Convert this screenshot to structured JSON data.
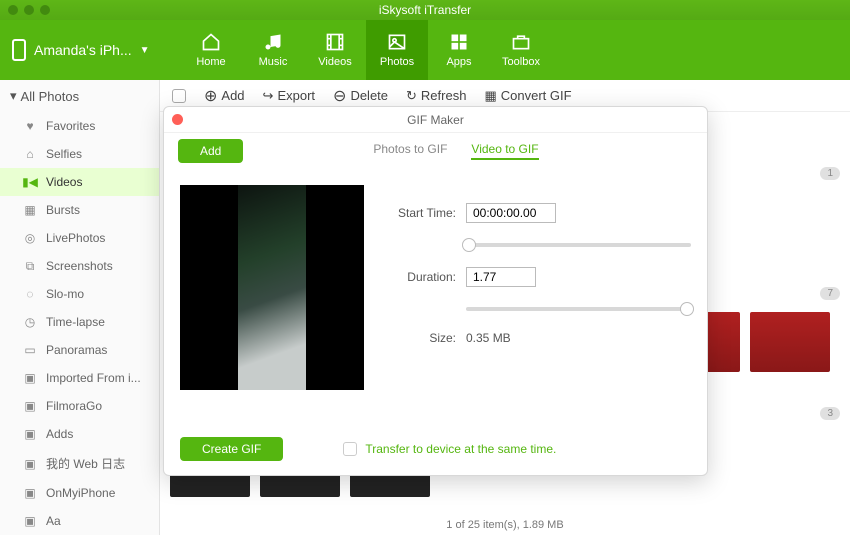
{
  "app": {
    "title": "iSkysoft iTransfer"
  },
  "device": {
    "name": "Amanda's  iPh..."
  },
  "nav": [
    {
      "label": "Home"
    },
    {
      "label": "Music"
    },
    {
      "label": "Videos"
    },
    {
      "label": "Photos",
      "active": true
    },
    {
      "label": "Apps"
    },
    {
      "label": "Toolbox"
    }
  ],
  "actions": {
    "add": "Add",
    "export": "Export",
    "delete": "Delete",
    "refresh": "Refresh",
    "convert": "Convert GIF"
  },
  "sidebar": {
    "header": "All Photos",
    "items": [
      {
        "label": "Favorites"
      },
      {
        "label": "Selfies"
      },
      {
        "label": "Videos",
        "active": true
      },
      {
        "label": "Bursts"
      },
      {
        "label": "LivePhotos"
      },
      {
        "label": "Screenshots"
      },
      {
        "label": "Slo-mo"
      },
      {
        "label": "Time-lapse"
      },
      {
        "label": "Panoramas"
      },
      {
        "label": "Imported From i..."
      },
      {
        "label": "FilmoraGo"
      },
      {
        "label": "Adds"
      },
      {
        "label": "我的 Web 日志"
      },
      {
        "label": "OnMyiPhone"
      },
      {
        "label": "Aa"
      }
    ]
  },
  "badges": {
    "b1": "1",
    "b2": "7",
    "b3": "3"
  },
  "status": "1 of 25 item(s), 1.89 MB",
  "modal": {
    "title": "GIF Maker",
    "add": "Add",
    "tab_photos": "Photos to GIF",
    "tab_video": "Video to GIF",
    "start_label": "Start Time:",
    "start_value": "00:00:00.00",
    "duration_label": "Duration:",
    "duration_value": "1.77",
    "size_label": "Size:",
    "size_value": "0.35 MB",
    "create": "Create GIF",
    "transfer": "Transfer to device at the same time."
  }
}
